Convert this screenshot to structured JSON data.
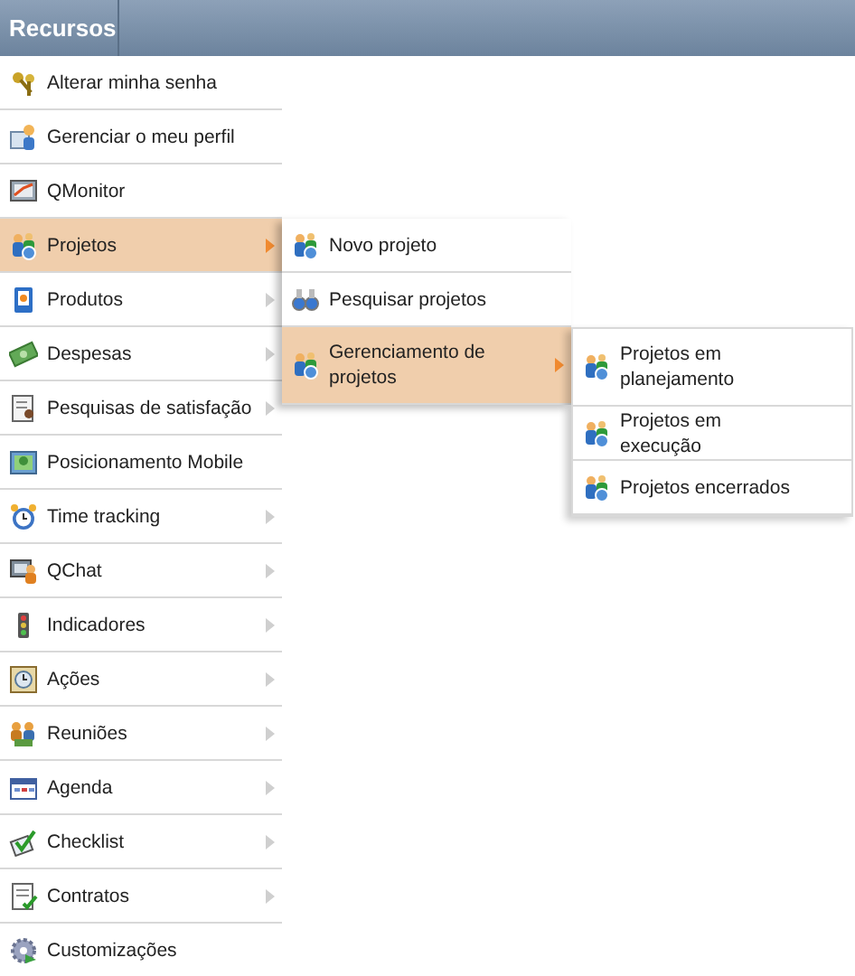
{
  "header": {
    "title": "Recursos"
  },
  "menu": [
    {
      "label": "Alterar minha senha",
      "has_submenu": false,
      "selected": false
    },
    {
      "label": "Gerenciar o meu perfil",
      "has_submenu": false,
      "selected": false
    },
    {
      "label": "QMonitor",
      "has_submenu": false,
      "selected": false
    },
    {
      "label": "Projetos",
      "has_submenu": true,
      "selected": true,
      "children": [
        {
          "label": "Novo projeto",
          "has_submenu": false,
          "selected": false
        },
        {
          "label": "Pesquisar projetos",
          "has_submenu": false,
          "selected": false
        },
        {
          "label": "Gerenciamento de projetos",
          "has_submenu": true,
          "selected": true,
          "children": [
            {
              "label": "Projetos em planejamento",
              "has_submenu": false,
              "selected": false
            },
            {
              "label": "Projetos em execução",
              "has_submenu": false,
              "selected": false
            },
            {
              "label": "Projetos encerrados",
              "has_submenu": false,
              "selected": false
            }
          ]
        }
      ]
    },
    {
      "label": "Produtos",
      "has_submenu": true,
      "selected": false
    },
    {
      "label": "Despesas",
      "has_submenu": true,
      "selected": false
    },
    {
      "label": "Pesquisas de satisfação",
      "has_submenu": true,
      "selected": false
    },
    {
      "label": "Posicionamento Mobile",
      "has_submenu": false,
      "selected": false
    },
    {
      "label": "Time tracking",
      "has_submenu": true,
      "selected": false
    },
    {
      "label": "QChat",
      "has_submenu": true,
      "selected": false
    },
    {
      "label": "Indicadores",
      "has_submenu": true,
      "selected": false
    },
    {
      "label": "Ações",
      "has_submenu": true,
      "selected": false
    },
    {
      "label": "Reuniões",
      "has_submenu": true,
      "selected": false
    },
    {
      "label": "Agenda",
      "has_submenu": true,
      "selected": false
    },
    {
      "label": "Checklist",
      "has_submenu": true,
      "selected": false
    },
    {
      "label": "Contratos",
      "has_submenu": true,
      "selected": false
    },
    {
      "label": "Customizações",
      "has_submenu": false,
      "selected": false
    }
  ]
}
